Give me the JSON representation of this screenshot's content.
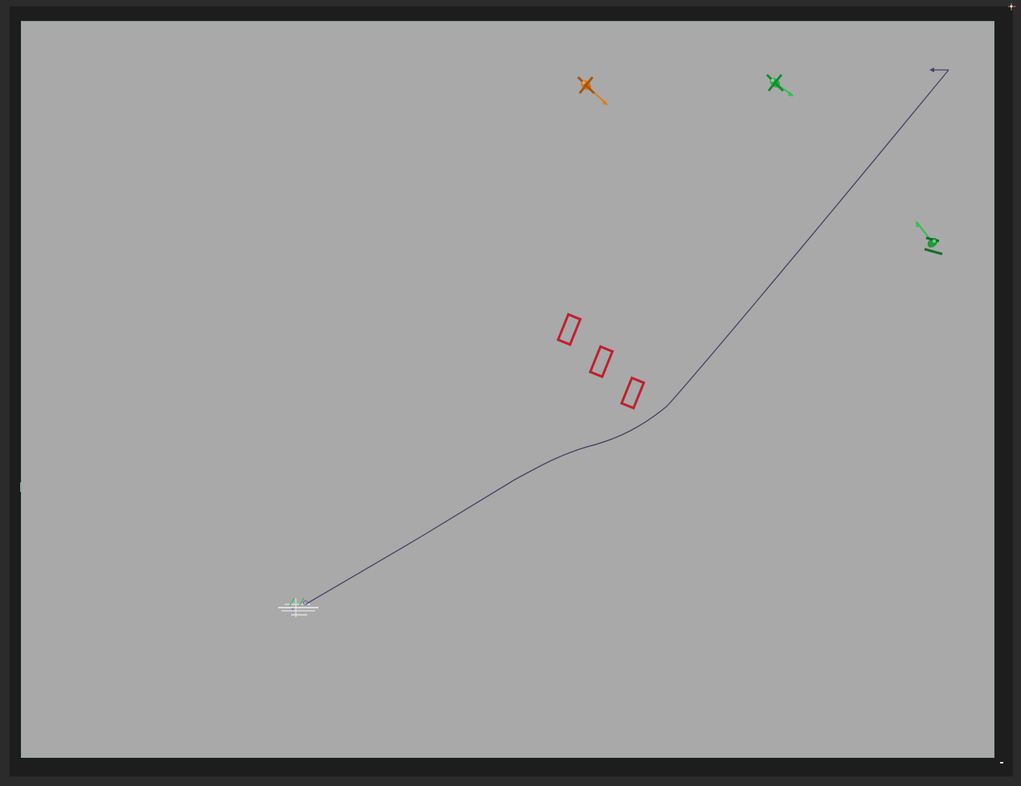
{
  "scene": {
    "title": "",
    "colors": {
      "background": "#a9a9a9",
      "frame": "#1d1d1d",
      "path": "#4a3f63",
      "obstacle": "#c0202e",
      "agent_orange": "#e07a1a",
      "agent_green": "#2ec24a",
      "agent_dark_green": "#1f9a3a",
      "start_marker": "#ffffff"
    },
    "path_label": "",
    "objects": [
      {
        "kind": "agent",
        "color_key": "agent_orange",
        "icon": "quadruped-agent-icon"
      },
      {
        "kind": "agent",
        "color_key": "agent_green",
        "icon": "quadruped-agent-icon"
      },
      {
        "kind": "agent",
        "color_key": "agent_dark_green",
        "icon": "quadruped-agent-icon"
      },
      {
        "kind": "obstacle",
        "count": 3,
        "icon": "box-obstacle-icon"
      },
      {
        "kind": "start",
        "icon": "spawn-point-icon"
      },
      {
        "kind": "goal",
        "icon": "goal-arrow-icon"
      }
    ]
  }
}
